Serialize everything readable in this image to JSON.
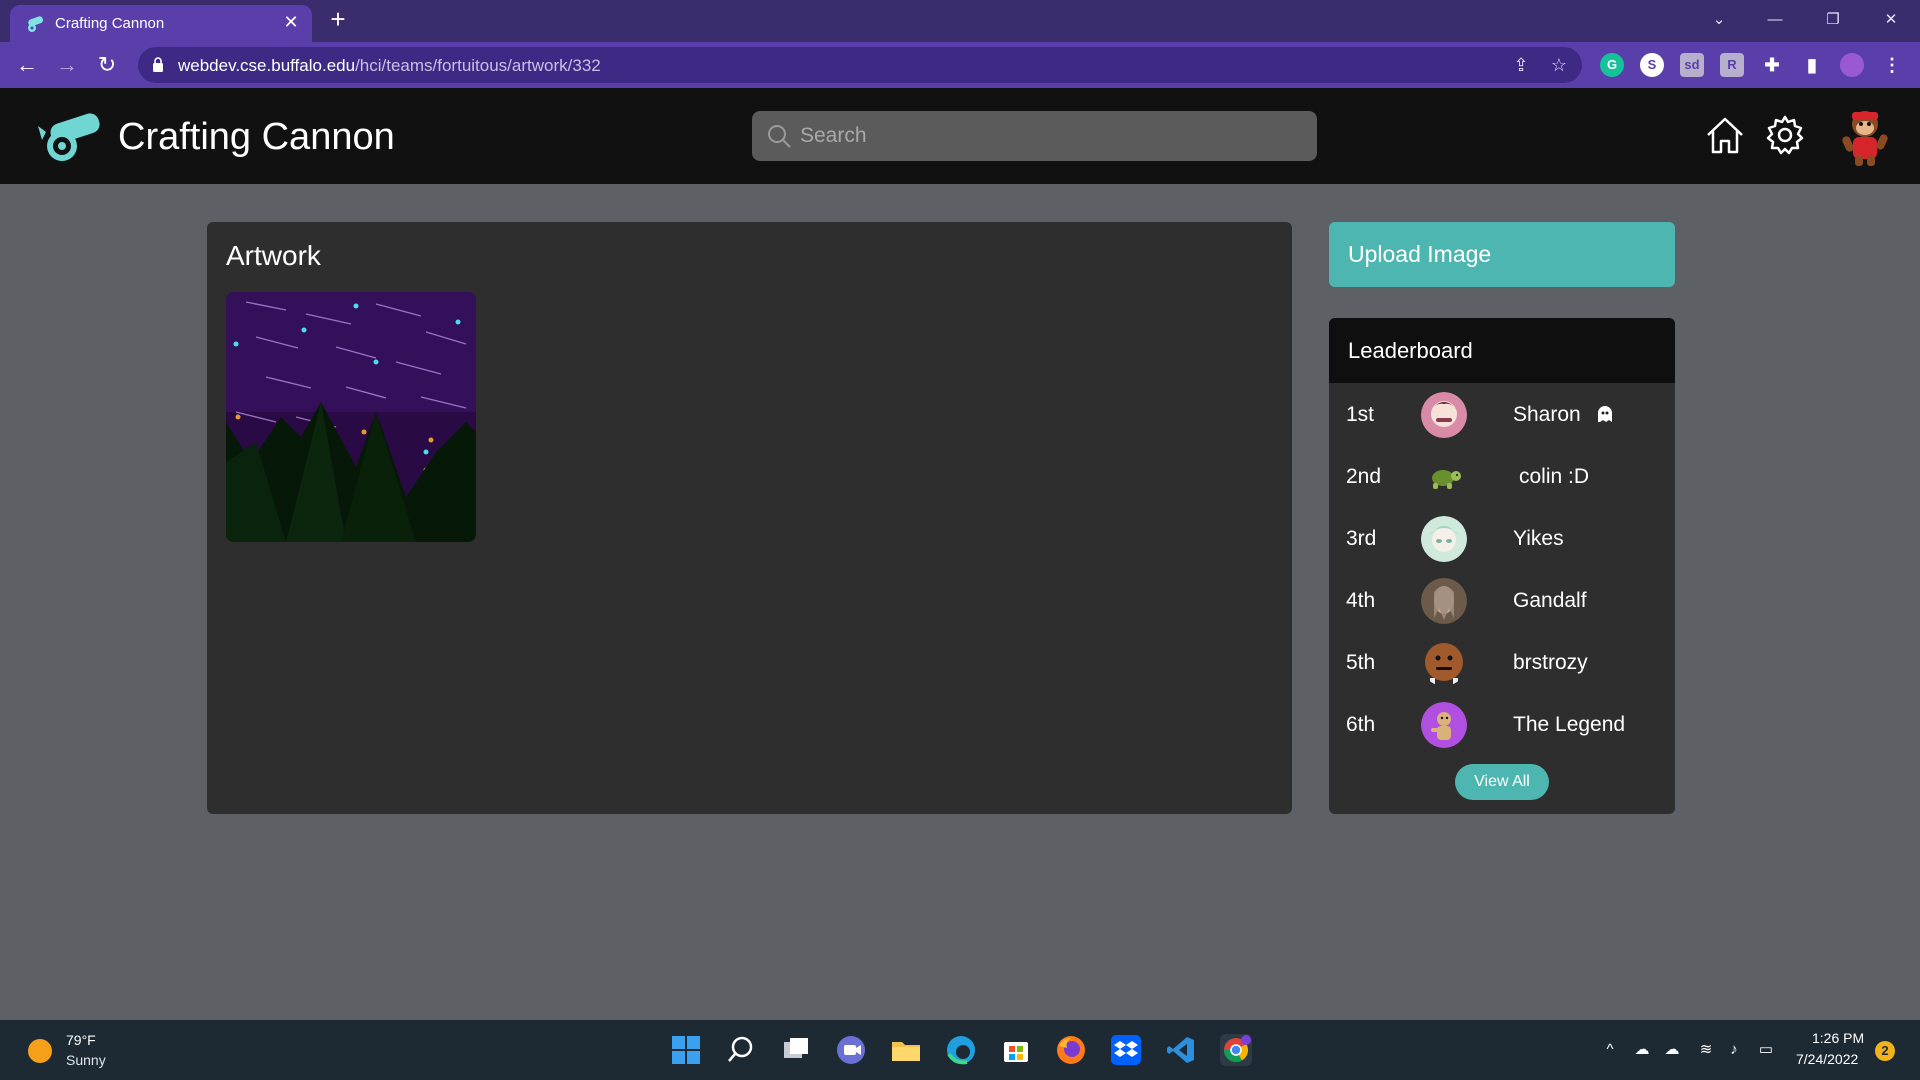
{
  "browser": {
    "tab_title": "Crafting Cannon",
    "close_tab": "✕",
    "new_tab": "+",
    "url_host": "webdev.cse.buffalo.edu",
    "url_path": "/hci/teams/fortuitous/artwork/332",
    "window_controls": {
      "dropdown": "⌄",
      "minimize": "—",
      "restore": "❐",
      "close": "✕"
    },
    "nav": {
      "back": "←",
      "forward": "→",
      "reload": "↻"
    }
  },
  "header": {
    "site_title": "Crafting Cannon",
    "search_placeholder": "Search"
  },
  "artwork": {
    "title": "Artwork"
  },
  "sidebar": {
    "upload_label": "Upload Image",
    "leaderboard_title": "Leaderboard",
    "entries": [
      {
        "rank": "1st",
        "name": "Sharon"
      },
      {
        "rank": "2nd",
        "name": "colin :D"
      },
      {
        "rank": "3rd",
        "name": "Yikes"
      },
      {
        "rank": "4th",
        "name": "Gandalf"
      },
      {
        "rank": "5th",
        "name": "brstrozy"
      },
      {
        "rank": "6th",
        "name": "The Legend"
      }
    ],
    "view_all_label": "View All"
  },
  "taskbar": {
    "temperature": "79°F",
    "condition": "Sunny",
    "time": "1:26 PM",
    "date": "7/24/2022",
    "notification_count": "2"
  },
  "colors": {
    "accent_teal": "#4db6b0",
    "browser_purple": "#5a3fab",
    "header_black": "#111111",
    "panel_dark": "#2e2e2e",
    "page_bg": "#5d6065"
  },
  "icons": [
    "cannon-logo-icon",
    "search-icon",
    "home-icon",
    "gear-icon",
    "ghost-icon",
    "lock-icon"
  ]
}
